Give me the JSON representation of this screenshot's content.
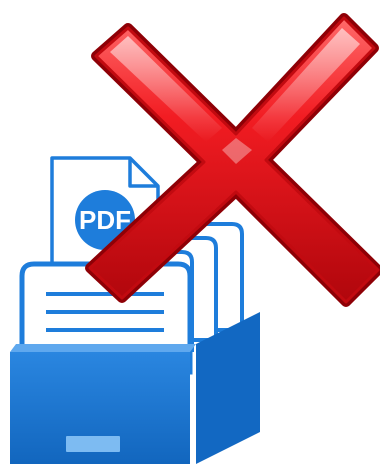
{
  "illustration": {
    "document_badge_text": "PDF",
    "icons": {
      "document": "pdf-document-icon",
      "folder_box": "file-box-icon",
      "cross": "red-x-icon"
    },
    "colors": {
      "blue_dark": "#1268c2",
      "blue": "#1e7ddb",
      "blue_light": "#5fa8ee",
      "red": "#e8141a",
      "red_dark": "#8e0006",
      "white": "#ffffff"
    }
  }
}
